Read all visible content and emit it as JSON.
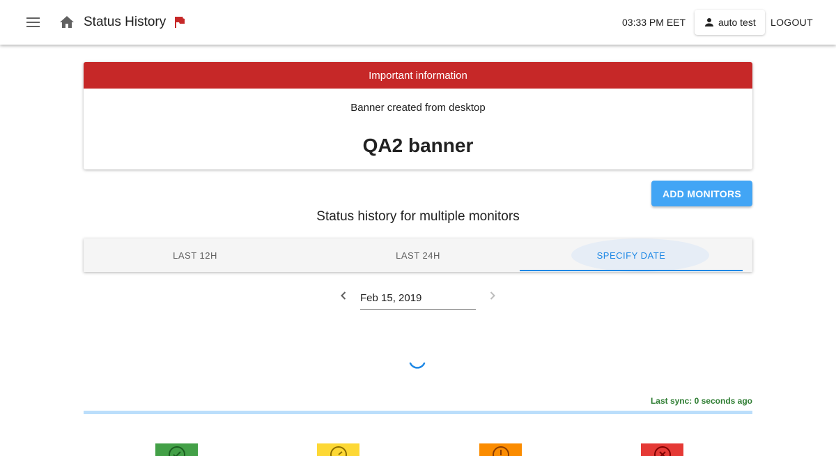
{
  "header": {
    "title": "Status History",
    "time": "03:33 PM EET",
    "user_name": "auto test",
    "logout_label": "LOGOUT"
  },
  "banner": {
    "heading": "Important information",
    "subtitle": "Banner created from desktop",
    "message": "QA2 banner",
    "color": "#c62828"
  },
  "actions": {
    "add_monitors_label": "ADD MONITORS"
  },
  "section_title": "Status history for multiple monitors",
  "tabs": [
    {
      "label": "LAST 12H",
      "active": false
    },
    {
      "label": "LAST 24H",
      "active": false
    },
    {
      "label": "SPECIFY DATE",
      "active": true
    }
  ],
  "date_picker": {
    "value": "Feb 15, 2019"
  },
  "sync_status": "Last sync: 0 seconds ago",
  "status_tiles": [
    {
      "name": "up",
      "icon": "check-circle-icon",
      "color": "#43a047"
    },
    {
      "name": "degraded",
      "icon": "speedometer-icon",
      "color": "#fdd835"
    },
    {
      "name": "warning",
      "icon": "alert-circle-icon",
      "color": "#fb8c00"
    },
    {
      "name": "down",
      "icon": "close-circle-icon",
      "color": "#e53935"
    }
  ],
  "colors": {
    "accent": "#1e88e5",
    "button": "#42a5f5",
    "sync_text": "#2e7d32"
  }
}
